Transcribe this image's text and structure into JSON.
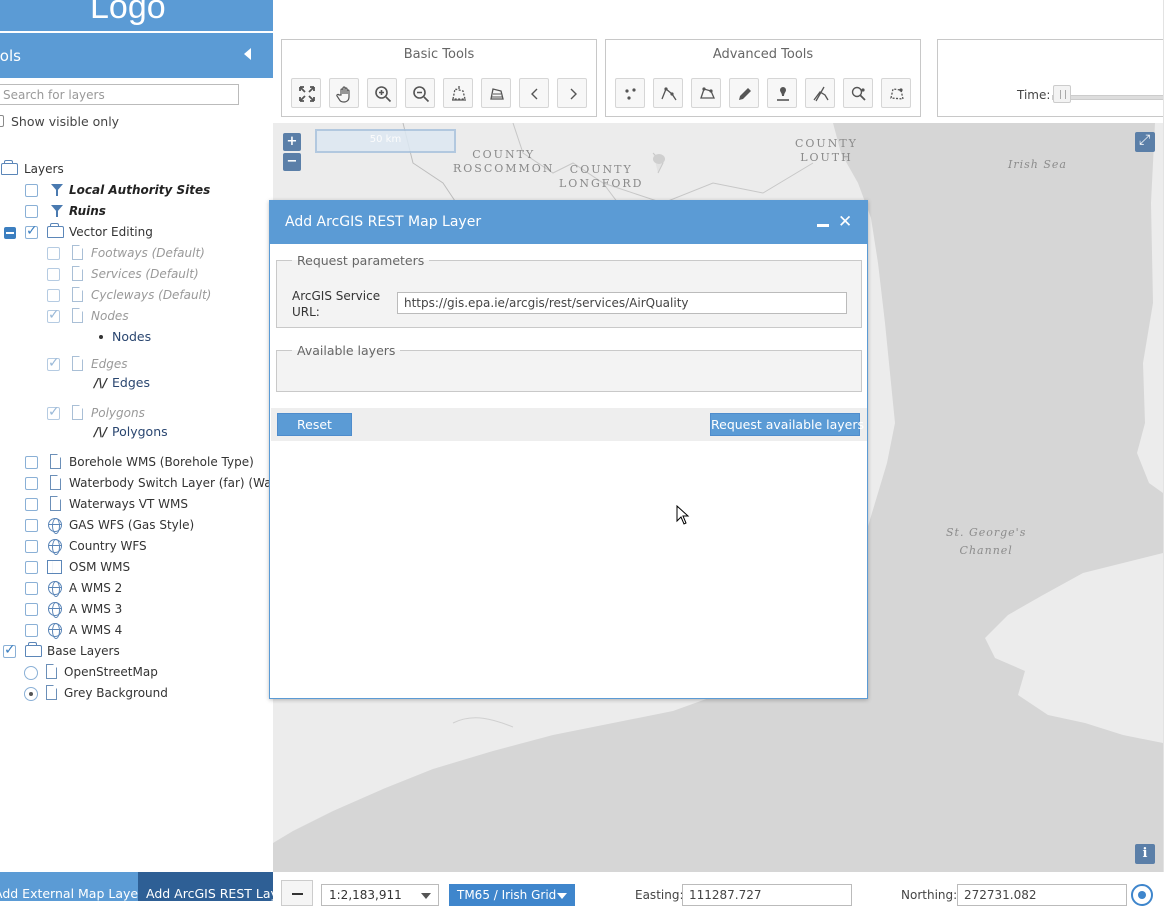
{
  "left_panel": {
    "logo": "Logo",
    "tools_title": "Tools",
    "search_placeholder": "Search for layers",
    "show_visible_only": "Show visible only",
    "layers_root": "Layers",
    "layers": {
      "local_authority": "Local Authority Sites",
      "ruins": "Ruins",
      "vector_editing": "Vector Editing",
      "footways": "Footways (Default)",
      "services": "Services (Default)",
      "cycleways": "Cycleways (Default)",
      "nodes": "Nodes",
      "nodes_sub": "Nodes",
      "edges": "Edges",
      "edges_sub": "Edges",
      "polygons": "Polygons",
      "polygons_sub": "Polygons",
      "borehole": "Borehole WMS (Borehole Type)",
      "waterbody": "Waterbody Switch Layer (far) (Wat...",
      "waterways": "Waterways VT WMS",
      "gas": "GAS WFS (Gas Style)",
      "country": "Country WFS",
      "osm_wms": "OSM WMS",
      "awms2": "A WMS 2",
      "awms3": "A WMS 3",
      "awms4": "A WMS 4"
    },
    "base_layers_root": "Base Layers",
    "base_layers": {
      "osm": "OpenStreetMap",
      "grey": "Grey Background"
    },
    "bottom_tabs": {
      "external": "Add External Map Layer",
      "arcgis": "Add ArcGIS REST Layer"
    }
  },
  "toolbar": {
    "basic_title": "Basic Tools",
    "advanced_title": "Advanced Tools",
    "time_label": "Time:"
  },
  "map": {
    "scale_text": "50 km",
    "labels": {
      "roscommon_1": "COUNTY",
      "roscommon_2": "ROSCOMMON",
      "longford_1": "COUNTY",
      "longford_2": "LONGFORD",
      "louth_1": "COUNTY",
      "louth_2": "LOUTH",
      "irish_sea": "Irish Sea",
      "st_georges_1": "St. George's",
      "st_georges_2": "Channel"
    },
    "zoom_in": "+",
    "zoom_out": "−",
    "info": "i"
  },
  "bottom_bar": {
    "scale_value": "1:2,183,911",
    "crs_value": "TM65 / Irish Grid",
    "easting_label": "Easting:",
    "easting_value": "111287.727",
    "northing_label": "Northing:",
    "northing_value": "272731.082"
  },
  "dialog": {
    "title": "Add ArcGIS REST Map Layer",
    "close_glyph": "✕",
    "params_legend": "Request parameters",
    "url_label": "ArcGIS Service URL:",
    "url_value": "https://gis.epa.ie/arcgis/rest/services/AirQuality",
    "layers_legend": "Available layers",
    "reset_label": "Reset",
    "request_label": "Request available layers"
  },
  "colors": {
    "accent": "#5b9bd5",
    "accent_dark": "#2e5f95",
    "map_sea": "#d6d6d6",
    "map_land": "#ececec"
  }
}
